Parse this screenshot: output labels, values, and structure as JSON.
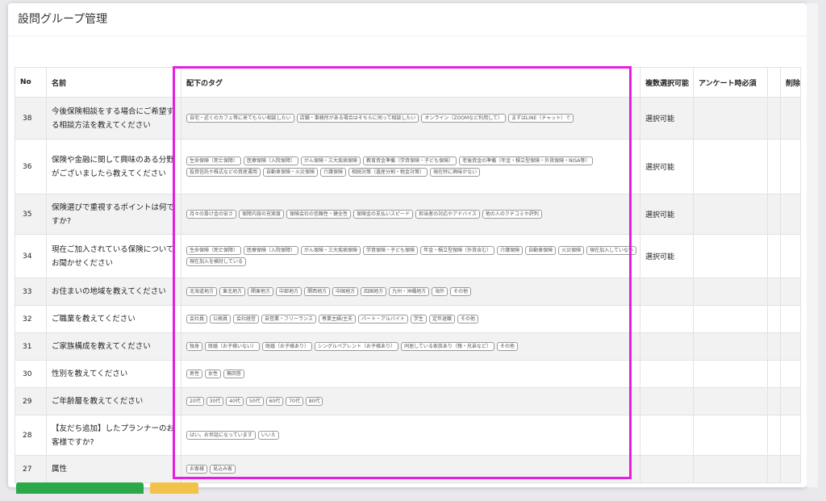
{
  "page": {
    "title": "設問グループ管理"
  },
  "table": {
    "headers": {
      "no": "No",
      "name": "名前",
      "tags": "配下のタグ",
      "multi": "複数選択可能",
      "required": "アンケート時必須",
      "blank": "",
      "delete": "削除"
    },
    "rows": [
      {
        "no": "38",
        "name": "今後保険相談をする場合にご希望する相談方法を教えてください",
        "multi": "選択可能",
        "tags": [
          "自宅・近くのカフェ等に来てもらい相談したい",
          "店舗・事務所がある場合はそちらに伺って相談したい",
          "オンライン（ZOOMなど利用して）",
          "まずはLINE（チャット）で"
        ]
      },
      {
        "no": "36",
        "name": "保険や金融に関して興味のある分野がございましたら教えてください",
        "multi": "選択可能",
        "tags": [
          "生命保険（死亡保障）",
          "医療保険（入院保障）",
          "がん保険・三大疾病保険",
          "教育資金準備（学資保険・子ども保険）",
          "老後資金の準備（年金・積立型保険・外貨保険・NISA等）",
          "投資信託や株式などの資産運用",
          "自動車保険・火災保険",
          "介護保険",
          "相続対策（遺産分割・税金対策）",
          "現在特に興味がない"
        ]
      },
      {
        "no": "35",
        "name": "保険選びで重視するポイントは何ですか?",
        "multi": "選択可能",
        "tags": [
          "月々の掛け金の安さ",
          "保障内容の充実度",
          "保険会社の信頼性・健全性",
          "保険金の支払いスピード",
          "担当者の対応やアドバイス",
          "他の人のクチコミや評判"
        ]
      },
      {
        "no": "34",
        "name": "現在ご加入されている保険についてお聞かせください",
        "multi": "選択可能",
        "tags": [
          "生命保険（死亡保障）",
          "医療保険（入院保障）",
          "がん保険・三大疾病保険",
          "学資保険・子ども保険",
          "年金・積立型保険（外貨含む）",
          "介護保険",
          "自動車保険",
          "火災保険",
          "現在加入していない",
          "現在加入を検討している"
        ]
      },
      {
        "no": "33",
        "name": "お住まいの地域を教えてください",
        "multi": "",
        "tags": [
          "北海道地方",
          "東北地方",
          "関東地方",
          "中部地方",
          "関西地方",
          "中国地方",
          "四国地方",
          "九州・沖縄地方",
          "海外",
          "その他"
        ]
      },
      {
        "no": "32",
        "name": "ご職業を教えてください",
        "multi": "",
        "tags": [
          "会社員",
          "公務員",
          "会社経営",
          "自営業・フリーランス",
          "専業主婦/主夫",
          "パート・アルバイト",
          "学生",
          "定年退職",
          "その他"
        ]
      },
      {
        "no": "31",
        "name": "ご家族構成を教えてください",
        "multi": "",
        "tags": [
          "独身",
          "既婚（お子様いない）",
          "既婚（お子様あり）",
          "シングルペアレント（お子様あり）",
          "同居している家族あり（親・兄弟など）",
          "その他"
        ]
      },
      {
        "no": "30",
        "name": "性別を教えてください",
        "multi": "",
        "tags": [
          "男性",
          "女性",
          "無回答"
        ]
      },
      {
        "no": "29",
        "name": "ご年齢層を教えてください",
        "multi": "",
        "tags": [
          "20代",
          "30代",
          "40代",
          "50代",
          "60代",
          "70代",
          "80代"
        ]
      },
      {
        "no": "28",
        "name": "【友だち追加】したプランナーのお客様ですか?",
        "multi": "",
        "tags": [
          "はい。お世話になっています",
          "いいえ"
        ]
      },
      {
        "no": "27",
        "name": "属性",
        "multi": "",
        "tags": [
          "お客様",
          "見込み客"
        ]
      }
    ]
  },
  "colors": {
    "highlight": "#e61ee0",
    "primary_button": "#2aa84a",
    "secondary_button": "#f3c24a"
  }
}
